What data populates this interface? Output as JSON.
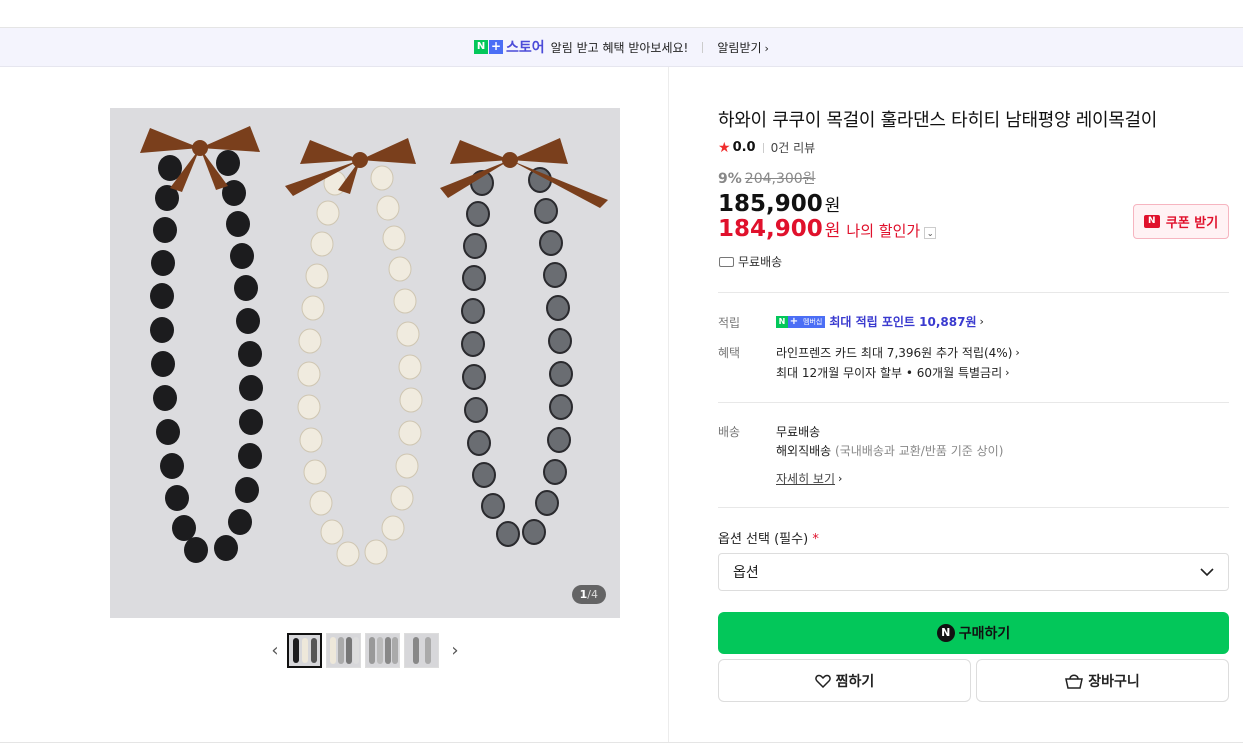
{
  "banner": {
    "n_label": "N",
    "plus_label": "+",
    "store_label": "스토어",
    "message": "알림 받고 혜택 받아보세요!",
    "action_label": "알림받기"
  },
  "gallery": {
    "current": "1",
    "total": "/4",
    "thumb_count": 4
  },
  "product": {
    "title": "하와이 쿠쿠이 목걸이 훌라댄스 타히티 남태평양 레이목걸이",
    "rating": "0.0",
    "review_count": "0건 리뷰",
    "discount_rate": "9%",
    "original_price": "204,300원",
    "price": "185,900",
    "price_unit": "원",
    "my_price": "184,900",
    "my_price_unit": "원",
    "my_price_label": "나의 할인가",
    "shipping_summary": "무료배송",
    "coupon_label": "쿠폰 받기",
    "coupon_badge": "N"
  },
  "benefits": {
    "points_label": "적립",
    "membership_badge": "멤버십",
    "points_text": "최대 적립 포인트 10,887원",
    "benefit_label": "혜택",
    "benefit_line1": "라인프렌즈 카드 최대 7,396원 추가 적립(4%)",
    "benefit_line2": "최대 12개월 무이자 할부 • 60개월 특별금리"
  },
  "delivery": {
    "label": "배송",
    "line1": "무료배송",
    "line2_main": "해외직배송",
    "line2_sub": "(국내배송과 교환/반품 기준 상이)",
    "detail_link": "자세히 보기"
  },
  "options": {
    "label": "옵션 선택 (필수)",
    "required_mark": "*",
    "select_value": "옵션"
  },
  "actions": {
    "buy_icon": "N",
    "buy_label": "구매하기",
    "wish_label": "찜하기",
    "cart_label": "장바구니"
  },
  "colors": {
    "naver_green": "#03c75a",
    "sale_red": "#e0112c",
    "point_blue": "#3a3acf"
  }
}
